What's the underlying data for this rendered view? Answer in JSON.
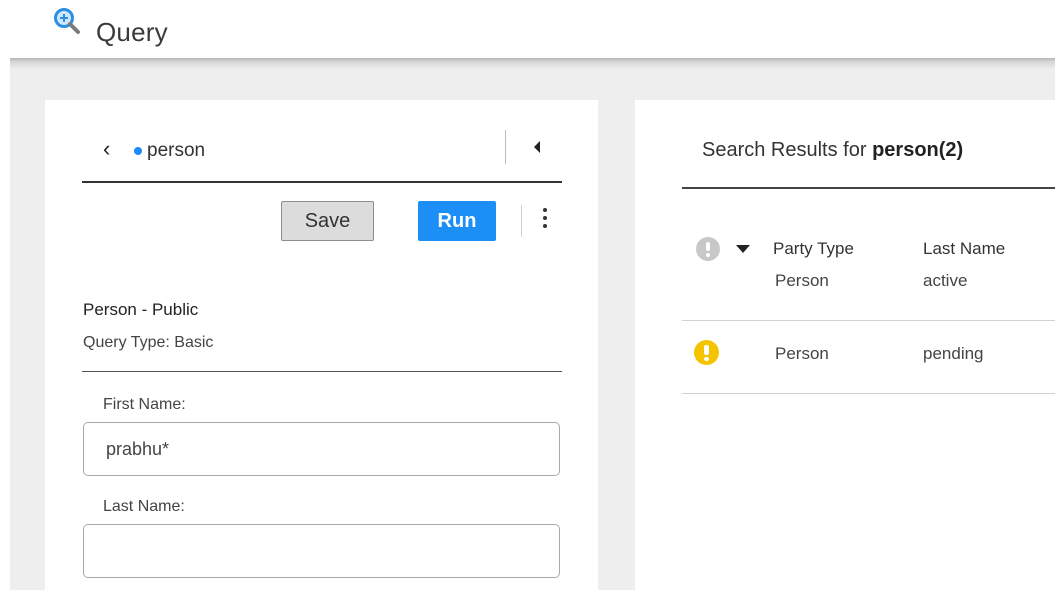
{
  "app": {
    "title": "Query",
    "icon": "query-magnifier-icon"
  },
  "query_panel": {
    "name": "person",
    "unsaved_indicator": true,
    "toolbar": {
      "save_label": "Save",
      "run_label": "Run"
    },
    "query_title": "Person - Public",
    "query_type": "Query Type: Basic",
    "fields": [
      {
        "label": "First Name:",
        "value": "prabhu*",
        "placeholder": ""
      },
      {
        "label": "Last Name:",
        "value": "",
        "placeholder": ""
      }
    ]
  },
  "results": {
    "heading_prefix": "Search Results for ",
    "heading_term": "person(2)",
    "columns": [
      "Party Type",
      "Last Name"
    ],
    "rows": [
      {
        "warning": false,
        "party_type": "Person",
        "last_name": "active"
      },
      {
        "warning": true,
        "party_type": "Person",
        "last_name": "pending"
      }
    ]
  },
  "colors": {
    "accent": "#1b8ff5",
    "warning": "#f5c400",
    "unsaved_dot": "#1a8cff"
  }
}
